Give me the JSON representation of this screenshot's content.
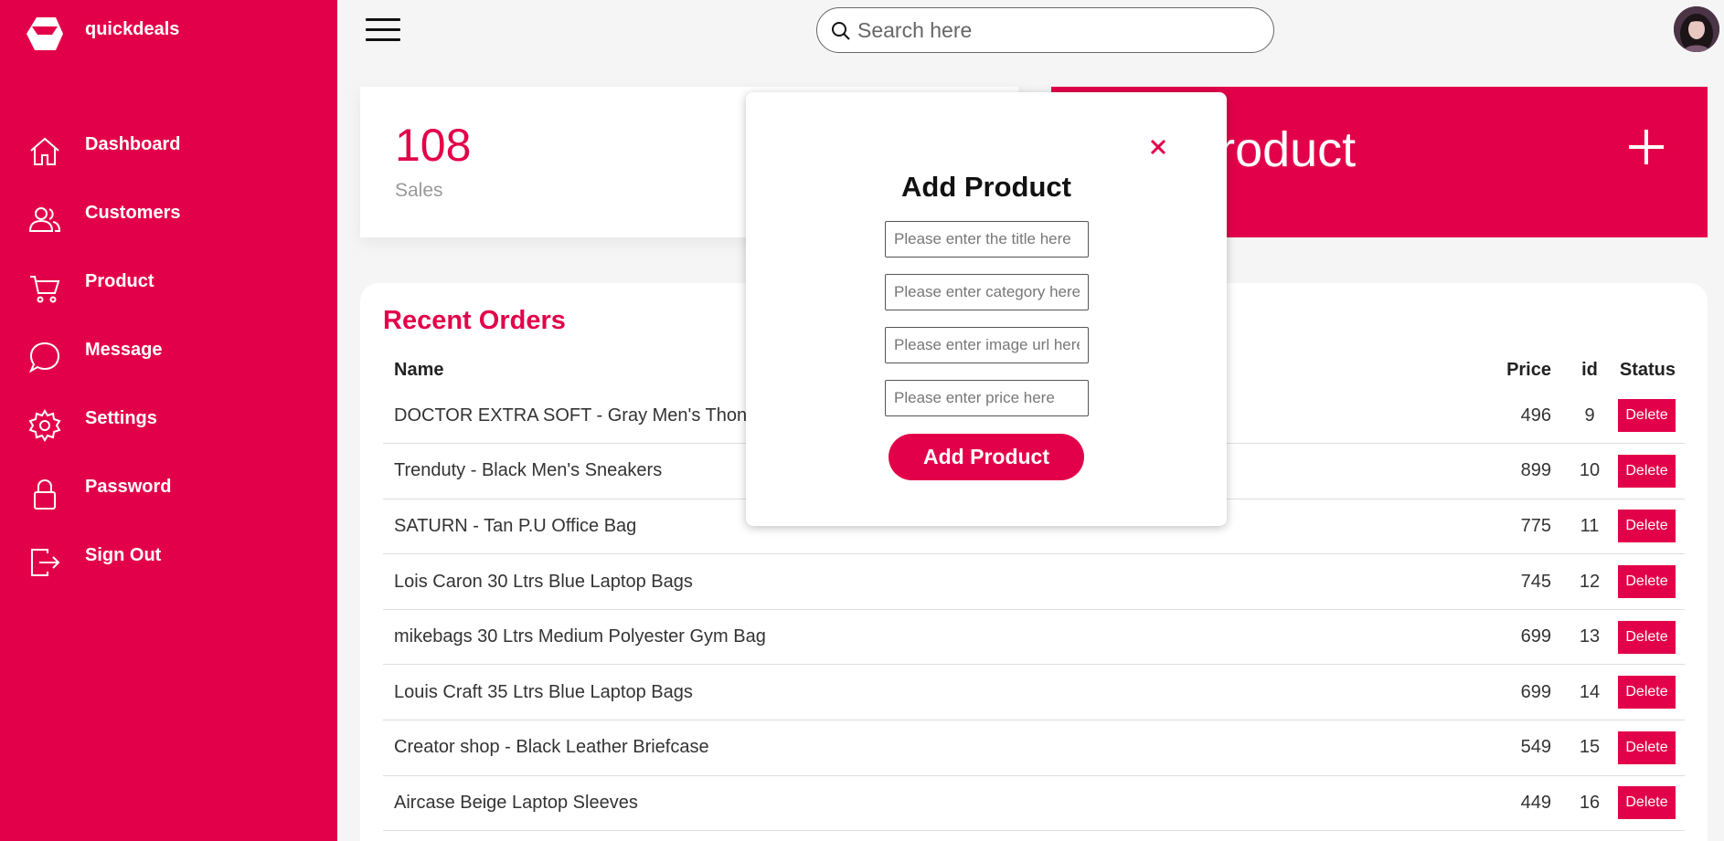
{
  "brand": {
    "name": "quickdeals",
    "logo_icon": "box-logo-icon"
  },
  "colors": {
    "primary": "#e3004a"
  },
  "sidebar": {
    "items": [
      {
        "label": "Dashboard",
        "icon": "home-icon"
      },
      {
        "label": "Customers",
        "icon": "users-icon"
      },
      {
        "label": "Product",
        "icon": "cart-icon"
      },
      {
        "label": "Message",
        "icon": "chat-icon"
      },
      {
        "label": "Settings",
        "icon": "gear-icon"
      },
      {
        "label": "Password",
        "icon": "lock-icon"
      },
      {
        "label": "Sign Out",
        "icon": "sign-out-icon"
      }
    ]
  },
  "topbar": {
    "search_placeholder": "Search here"
  },
  "cards": {
    "sales": {
      "value": "108",
      "label": "Sales"
    },
    "add_product": {
      "title": "Add Product"
    }
  },
  "orders": {
    "title": "Recent Orders",
    "columns": {
      "name": "Name",
      "price": "Price",
      "id": "id",
      "status": "Status"
    },
    "delete_label": "Delete",
    "rows": [
      {
        "name": "DOCTOR EXTRA SOFT - Gray Men's Thong",
        "price": "496",
        "id": "9"
      },
      {
        "name": "Trenduty - Black Men's Sneakers",
        "price": "899",
        "id": "10"
      },
      {
        "name": "SATURN - Tan P.U Office Bag",
        "price": "775",
        "id": "11"
      },
      {
        "name": "Lois Caron 30 Ltrs Blue Laptop Bags",
        "price": "745",
        "id": "12"
      },
      {
        "name": "mikebags 30 Ltrs Medium Polyester Gym Bag",
        "price": "699",
        "id": "13"
      },
      {
        "name": "Louis Craft 35 Ltrs Blue Laptop Bags",
        "price": "699",
        "id": "14"
      },
      {
        "name": "Creator shop - Black Leather Briefcase",
        "price": "549",
        "id": "15"
      },
      {
        "name": "Aircase Beige Laptop Sleeves",
        "price": "449",
        "id": "16"
      }
    ]
  },
  "modal": {
    "title": "Add Product",
    "close_icon": "close-icon",
    "inputs": {
      "title_placeholder": "Please enter the title here",
      "category_placeholder": "Please enter category here",
      "image_placeholder": "Please enter image url here",
      "price_placeholder": "Please enter price here"
    },
    "submit_label": "Add Product"
  }
}
